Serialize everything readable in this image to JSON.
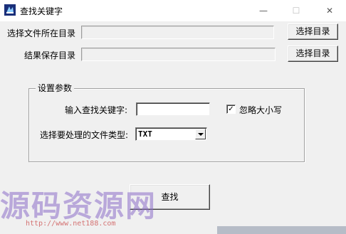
{
  "window": {
    "title": "查找关键字",
    "minimize_glyph": "—",
    "maximize_glyph": "☐",
    "close_glyph": "✕",
    "icon": "app-icon"
  },
  "source_dir": {
    "label": "选择文件所在目录",
    "value": "",
    "button_label": "选择目录"
  },
  "result_dir": {
    "label": "结果保存目录",
    "value": "",
    "button_label": "选择目录"
  },
  "settings": {
    "group_title": "设置参数",
    "keyword_label": "输入查找关键字:",
    "keyword_value": "",
    "ignore_case_label": "忽略大小写",
    "ignore_case_checked": true,
    "ignore_case_mark": "✓",
    "filetype_label": "选择要处理的文件类型:",
    "filetype_value": "TXT"
  },
  "search_button": {
    "label": "查找"
  },
  "watermark": {
    "text": "源码资源网",
    "url": "http://www.net188.com"
  }
}
